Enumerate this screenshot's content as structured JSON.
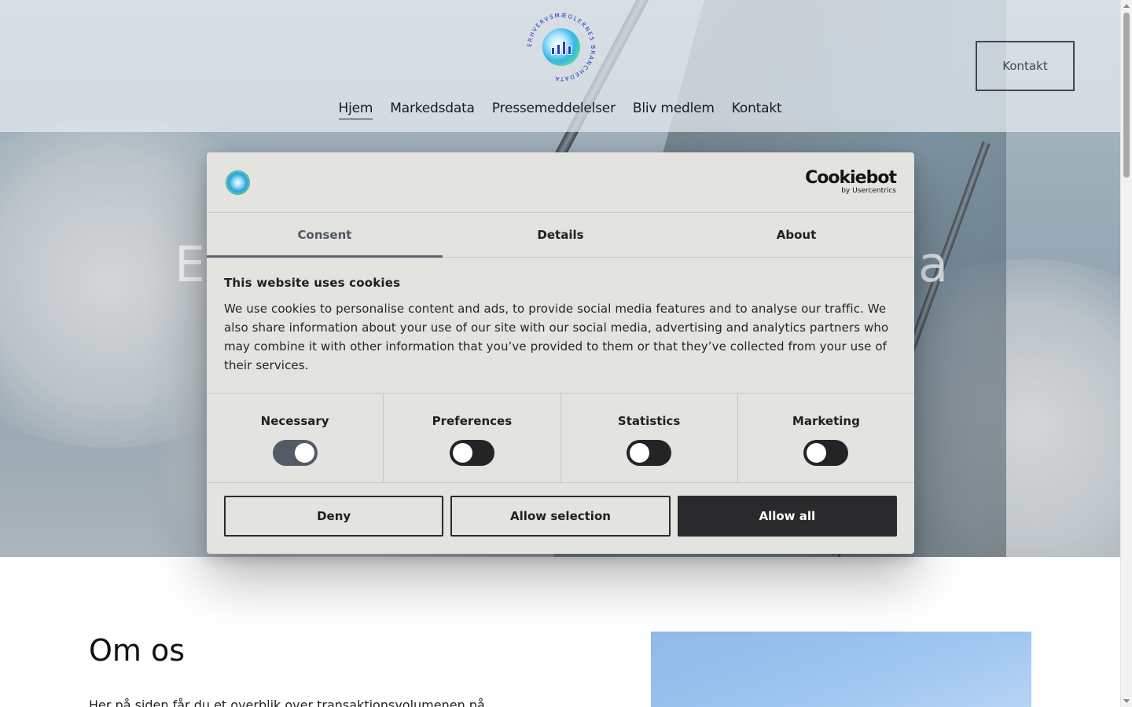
{
  "header": {
    "logo_ring_text": "ERHVERVSMÆGLERNES BRANCHEDATA",
    "nav": [
      "Hjem",
      "Markedsdata",
      "Pressemeddelelser",
      "Bliv medlem",
      "Kontakt"
    ],
    "active_nav": "Hjem",
    "cta_label": "Kontakt"
  },
  "hero": {
    "title_left": "Er",
    "title_right": "a"
  },
  "about": {
    "title": "Om os",
    "text_partial": "Her på siden får du et overblik over transaktionsvolumenen på"
  },
  "cookie": {
    "brand_name": "Cookiebot",
    "brand_by": "by Usercentrics",
    "tabs": [
      "Consent",
      "Details",
      "About"
    ],
    "active_tab": "Consent",
    "heading": "This website uses cookies",
    "body": "We use cookies to personalise content and ads, to provide social media features and to analyse our traffic. We also share information about your use of our site with our social media, advertising and analytics partners who may combine it with other information that you’ve provided to them or that they’ve collected from your use of their services.",
    "toggles": [
      {
        "label": "Necessary",
        "on": true
      },
      {
        "label": "Preferences",
        "on": false
      },
      {
        "label": "Statistics",
        "on": false
      },
      {
        "label": "Marketing",
        "on": false
      }
    ],
    "buttons": {
      "deny": "Deny",
      "allow_selection": "Allow selection",
      "allow_all": "Allow all"
    }
  },
  "colors": {
    "dialog_bg": "#e3e3df",
    "allow_all_bg": "#2a2a2c",
    "toggle_on": "#545b66",
    "toggle_off": "#232425"
  }
}
